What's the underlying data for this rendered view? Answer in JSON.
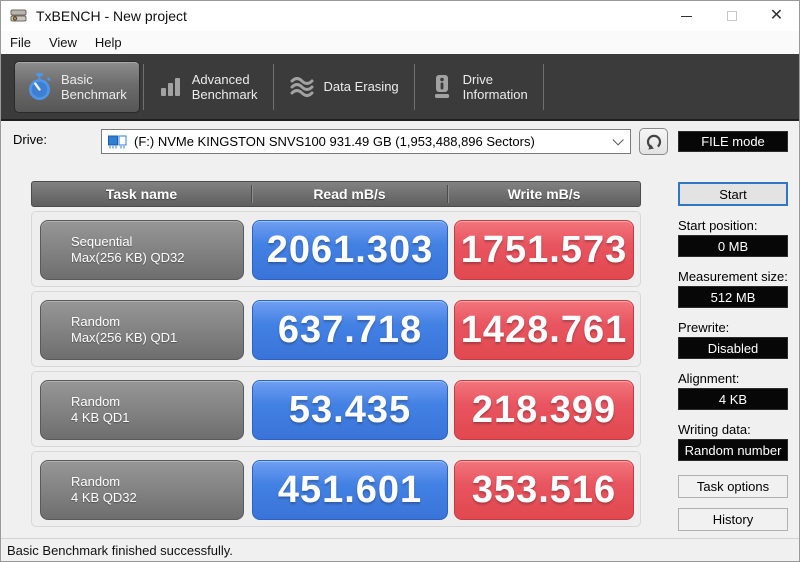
{
  "colors": {
    "read_blue": "#4080e0",
    "write_red": "#e8525c",
    "toolbar_bg": "#3b3b3b",
    "value_box_bg": "#070707"
  },
  "window": {
    "title": "TxBENCH - New project",
    "icons": [
      "app-icon",
      "minimize-icon",
      "maximize-icon",
      "close-icon"
    ]
  },
  "menu": {
    "items": [
      {
        "label": "File"
      },
      {
        "label": "View"
      },
      {
        "label": "Help"
      }
    ]
  },
  "toolbar": {
    "tabs": [
      {
        "icon": "stopwatch-icon",
        "label": "Basic\nBenchmark",
        "active": true
      },
      {
        "icon": "bar-chart-icon",
        "label": "Advanced\nBenchmark",
        "active": false
      },
      {
        "icon": "erase-waves-icon",
        "label": "Data Erasing",
        "active": false
      },
      {
        "icon": "drive-info-icon",
        "label": "Drive\nInformation",
        "active": false
      }
    ]
  },
  "drive_row": {
    "label": "Drive:",
    "selected": "(F:) NVMe KINGSTON SNVS100  931.49 GB (1,953,488,896 Sectors)",
    "icons": [
      "drive-icon",
      "chevron-down-icon",
      "refresh-icon"
    ],
    "mode_badge": "FILE mode"
  },
  "benchmark_table": {
    "headers": [
      "Task name",
      "Read mB/s",
      "Write mB/s"
    ],
    "rows": [
      {
        "task": "Sequential\nMax(256 KB) QD32",
        "read": "2061.303",
        "write": "1751.573"
      },
      {
        "task": "Random\nMax(256 KB) QD1",
        "read": "637.718",
        "write": "1428.761"
      },
      {
        "task": "Random\n4 KB QD1",
        "read": "53.435",
        "write": "218.399"
      },
      {
        "task": "Random\n4 KB QD32",
        "read": "451.601",
        "write": "353.516"
      }
    ]
  },
  "sidebar": {
    "start_button": "Start",
    "fields": [
      {
        "label": "Start position:",
        "value": "0 MB"
      },
      {
        "label": "Measurement size:",
        "value": "512 MB"
      },
      {
        "label": "Prewrite:",
        "value": "Disabled"
      },
      {
        "label": "Alignment:",
        "value": "4 KB"
      },
      {
        "label": "Writing data:",
        "value": "Random number"
      }
    ],
    "task_options_button": "Task options",
    "history_button": "History"
  },
  "status_bar": {
    "text": "Basic Benchmark finished successfully."
  }
}
